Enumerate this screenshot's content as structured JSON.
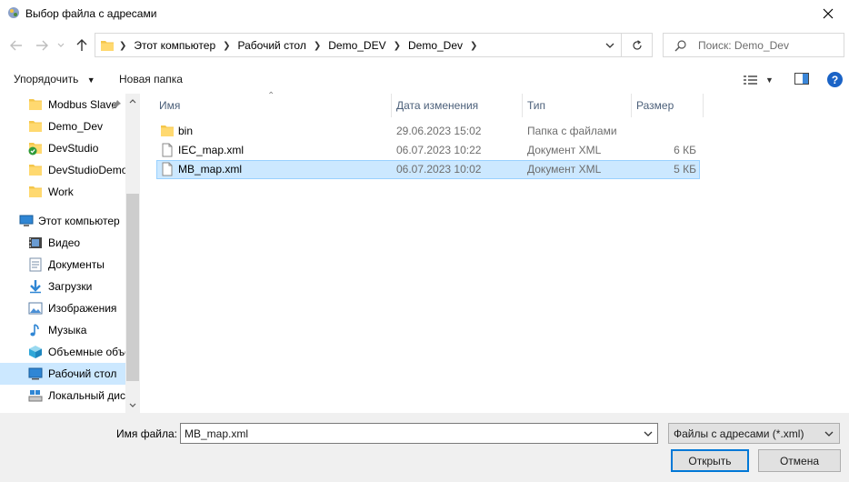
{
  "window": {
    "title": "Выбор файла с адресами"
  },
  "address": {
    "crumbs": [
      "Этот компьютер",
      "Рабочий стол",
      "Demo_DEV",
      "Demo_Dev"
    ]
  },
  "search": {
    "placeholder": "Поиск: Demo_Dev"
  },
  "toolbar": {
    "organize_label": "Упорядочить",
    "new_folder_label": "Новая папка"
  },
  "nav": {
    "items": [
      {
        "label": "Modbus Slave",
        "icon": "folder-icon",
        "pinned": true
      },
      {
        "label": "Demo_Dev",
        "icon": "folder-icon"
      },
      {
        "label": "DevStudio",
        "icon": "folder-check-icon"
      },
      {
        "label": "DevStudioDemo",
        "icon": "folder-icon"
      },
      {
        "label": "Work",
        "icon": "folder-icon"
      },
      {
        "label": "Этот компьютер",
        "icon": "computer-icon"
      },
      {
        "label": "Видео",
        "icon": "video-icon"
      },
      {
        "label": "Документы",
        "icon": "documents-icon"
      },
      {
        "label": "Загрузки",
        "icon": "downloads-icon"
      },
      {
        "label": "Изображения",
        "icon": "pictures-icon"
      },
      {
        "label": "Музыка",
        "icon": "music-icon"
      },
      {
        "label": "Объемные объекты",
        "icon": "3d-objects-icon"
      },
      {
        "label": "Рабочий стол",
        "icon": "desktop-icon",
        "selected": true
      },
      {
        "label": "Локальный диск",
        "icon": "drive-icon"
      }
    ]
  },
  "columns": {
    "name": "Имя",
    "date": "Дата изменения",
    "type": "Тип",
    "size": "Размер"
  },
  "files": [
    {
      "name": "bin",
      "date": "29.06.2023 15:02",
      "type": "Папка с файлами",
      "size": "",
      "icon": "folder-icon"
    },
    {
      "name": "IEC_map.xml",
      "date": "06.07.2023 10:22",
      "type": "Документ XML",
      "size": "6 КБ",
      "icon": "file-icon"
    },
    {
      "name": "MB_map.xml",
      "date": "06.07.2023 10:02",
      "type": "Документ XML",
      "size": "5 КБ",
      "icon": "file-icon",
      "selected": true
    }
  ],
  "footer": {
    "filename_label": "Имя файла:",
    "filename_value": "MB_map.xml",
    "filetype_value": "Файлы с адресами (*.xml)",
    "open_label": "Открыть",
    "cancel_label": "Отмена"
  },
  "colors": {
    "selection": "#cce8ff",
    "selection_border": "#99d1ff",
    "accent": "#0078d7",
    "header_text": "#4c607a"
  }
}
